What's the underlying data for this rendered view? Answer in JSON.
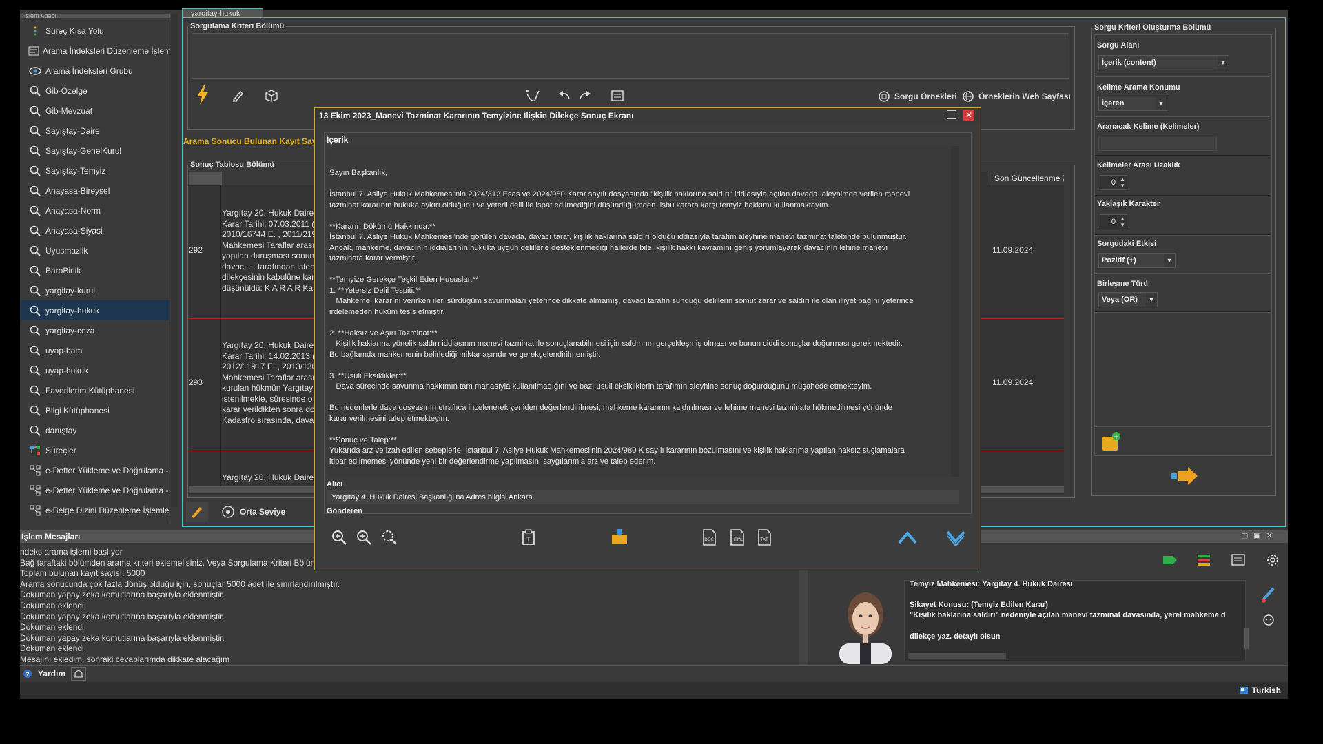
{
  "main_tab": "yargitay-hukuk",
  "sidebar": {
    "header": "İşlem Ağacı",
    "items": [
      {
        "label": "Süreç Kısa Yolu",
        "icon": "vertical-dots-icon"
      },
      {
        "label": "Arama İndeksleri Düzenleme İşlemleri",
        "icon": "edit-index-icon"
      },
      {
        "label": "Arama İndeksleri Grubu",
        "icon": "eye-icon"
      },
      {
        "label": "Gib-Özelge",
        "icon": "search-icon"
      },
      {
        "label": "Gib-Mevzuat",
        "icon": "search-icon"
      },
      {
        "label": "Sayıştay-Daire",
        "icon": "search-icon"
      },
      {
        "label": "Sayıştay-GenelKurul",
        "icon": "search-icon"
      },
      {
        "label": "Sayıştay-Temyiz",
        "icon": "search-icon"
      },
      {
        "label": "Anayasa-Bireysel",
        "icon": "search-icon"
      },
      {
        "label": "Anayasa-Norm",
        "icon": "search-icon"
      },
      {
        "label": "Anayasa-Siyasi",
        "icon": "search-icon"
      },
      {
        "label": "Uyusmazlik",
        "icon": "search-icon"
      },
      {
        "label": "BaroBirlik",
        "icon": "search-icon"
      },
      {
        "label": "yargitay-kurul",
        "icon": "search-icon"
      },
      {
        "label": "yargitay-hukuk",
        "icon": "search-icon"
      },
      {
        "label": "yargitay-ceza",
        "icon": "search-icon"
      },
      {
        "label": "uyap-bam",
        "icon": "search-icon"
      },
      {
        "label": "uyap-hukuk",
        "icon": "search-icon"
      },
      {
        "label": "Favorilerim Kütüphanesi",
        "icon": "search-icon"
      },
      {
        "label": "Bilgi Kütüphanesi",
        "icon": "search-icon"
      },
      {
        "label": "danıştay",
        "icon": "search-icon"
      },
      {
        "label": "Süreçler",
        "icon": "process-icon"
      },
      {
        "label": "e-Defter Yükleme ve Doğrulama -",
        "icon": "workflow-icon"
      },
      {
        "label": "e-Defter Yükleme ve Doğrulama -",
        "icon": "workflow-icon"
      },
      {
        "label": "e-Belge Dizini Düzenleme İşlemle",
        "icon": "workflow-icon"
      }
    ]
  },
  "query": {
    "legend": "Sorgulama Kriteri Bölümü",
    "examples_label": "Sorgu Örnekleri",
    "web_label": "Örneklerin Web Sayfası"
  },
  "results": {
    "count_label": "Arama Sonucu Bulunan Kayıt Sayısı",
    "legend": "Sonuç Tablosu Bölümü",
    "last_update_header": "Son Güncellenme Za",
    "rows": [
      {
        "num": "292",
        "text": "Yargıtay 20. Hukuk Dairesi\nKarar Tarihi: 07.03.2011 (\n2010/16744 E. , 2011/219\nMahkemesi Taraflar arası\nyapılan duruşması sonun\ndavacı ... tarafından isteni\ndilekçesinin kabulüne kar\ndüşünüldü: K A R A R Ka",
        "date": "11.09.2024"
      },
      {
        "num": "293",
        "text": "Yargıtay 20. Hukuk Daires\nKarar Tarihi: 14.02.2013 (\n2012/11917 E. , 2013/130\nMahkemesi Taraflar arası\nkurulan hükmün Yargıtay\nistenilmekle, süresinde o\nkarar verildikten sonra do\nKadastro sırasında, dava",
        "date": "11.09.2024"
      },
      {
        "num": "",
        "text": "Yargıtay 20. Hukuk Daires",
        "date": ""
      }
    ],
    "level_label": "Orta Seviye"
  },
  "criteria": {
    "legend": "Sorgu Kriteri Oluşturma Bölümü",
    "sorgu_alani_label": "Sorgu Alanı",
    "sorgu_alani_value": "İçerik (content)",
    "kelime_konum_label": "Kelime Arama Konumu",
    "kelime_konum_value": "İçeren",
    "aranacak_label": "Aranacak Kelime (Kelimeler)",
    "aranacak_value": "",
    "uzaklik_label": "Kelimeler Arası Uzaklık",
    "uzaklik_value": "0",
    "yaklasik_label": "Yaklaşık Karakter",
    "yaklasik_value": "0",
    "etki_label": "Sorgudaki Etkisi",
    "etki_value": "Pozitif (+)",
    "birlesme_label": "Birleşme Türü",
    "birlesme_value": "Veya (OR)"
  },
  "messages": {
    "header": "İşlem Mesajları",
    "lines": [
      "ndeks arama işlemi başlıyor",
      "Bağ taraftaki bölümden arama kriteri eklemelisiniz. Veya Sorgulama Kriteri Bölüm",
      "Toplam bulunan kayıt sayısı: 5000",
      "Arama sonucunda çok fazla dönüş olduğu için, sonuçlar 5000 adet ile sınırlandırılmıştır.",
      "Dokuman yapay zeka komutlarına başarıyla eklenmiştir.",
      "Dokuman eklendi",
      "Dokuman yapay zeka komutlarına başarıyla eklenmiştir.",
      "Dokuman eklendi",
      "Dokuman yapay zeka komutlarına başarıyla eklenmiştir.",
      "Dokuman eklendi",
      "Mesajını ekledim, sonraki cevaplarımda dikkate alacağım"
    ]
  },
  "chat": {
    "line1": "Temyiz Mahkemesi: Yargıtay 4. Hukuk Dairesi",
    "line2": "Şikayet Konusu: (Temyiz Edilen Karar)",
    "line3": "\"Kişilik haklarına saldırı\" nedeniyle açılan manevi tazminat davasında, yerel mahkeme d",
    "line4": "dilekçe yaz. detaylı olsun"
  },
  "status": {
    "help": "Yardım",
    "language": "Turkish"
  },
  "dialog": {
    "title": "13 Ekim 2023_Manevi Tazminat Kararının Temyizine İlişkin Dilekçe  Sonuç Ekranı",
    "content_label": "İçerik",
    "body": "Sayın Başkanlık,\n\nİstanbul 7. Asliye Hukuk Mahkemesi'nin 2024/312 Esas ve 2024/980 Karar sayılı dosyasında \"kişilik haklarına saldırı\" iddiasıyla açılan davada, aleyhimde verilen manevi\ntazminat kararının hukuka aykırı olduğunu ve yeterli delil ile ispat edilmediğini düşündüğümden, işbu karara karşı temyiz hakkımı kullanmaktayım.\n\n**Kararın Dökümü Hakkında:**\nİstanbul 7. Asliye Hukuk Mahkemesi'nde görülen davada, davacı taraf, kişilik haklarına saldırı olduğu iddiasıyla tarafım aleyhine manevi tazminat talebinde bulunmuştur.\nAncak, mahkeme, davacının iddialarının hukuka uygun delillerle desteklenmediği hallerde bile, kişilik hakkı kavramını geniş yorumlayarak davacının lehine manevi\ntazminata karar vermiştir.\n\n**Temyize Gerekçe Teşkil Eden Hususlar:**\n1. **Yetersiz Delil Tespiti:**\n   Mahkeme, kararını verirken ileri sürdüğüm savunmaları yeterince dikkate almamış, davacı tarafın sunduğu delillerin somut zarar ve saldırı ile olan illiyet bağını yeterince\nirdelemeden hüküm tesis etmiştir.\n\n2. **Haksız ve Aşırı Tazminat:**\n   Kişilik haklarına yönelik saldırı iddiasının manevi tazminat ile sonuçlanabilmesi için saldırının gerçekleşmiş olması ve bunun ciddi sonuçlar doğurması gerekmektedir.\nBu bağlamda mahkemenin belirlediği miktar aşırıdır ve gerekçelendirilmemiştir.\n\n3. **Usuli Eksiklikler:**\n   Dava sürecinde savunma hakkımın tam manasıyla kullanılmadığını ve bazı usuli eksikliklerin tarafımın aleyhine sonuç doğurduğunu müşahede etmekteyim.\n\nBu nedenlerle dava dosyasının etraflıca incelenerek yeniden değerlendirilmesi, mahkeme kararının kaldırılması ve lehime manevi tazminata hükmedilmesi yönünde\nkarar verilmesini talep etmekteyim.\n\n**Sonuç ve Talep:**\nYukarıda arz ve izah edilen sebeplerle, İstanbul 7. Asliye Hukuk Mahkemesi'nin 2024/980 K sayılı kararının bozulmasını ve kişilik haklarıma yapılan haksız suçlamalara\nitibar edilmemesi yönünde yeni bir değerlendirme yapılmasını saygılarımla arz ve talep ederim.",
    "alici_label": "Alıcı",
    "alici_value": "Yargıtay 4. Hukuk Dairesi Başkanlığı'na Adres bilgisi Ankara",
    "gonderen_label": "Gönderen"
  },
  "colors": {
    "accent": "#3fc5c5",
    "highlight": "#e8b020",
    "selected": "#1e3650",
    "close": "#d83a3a"
  }
}
